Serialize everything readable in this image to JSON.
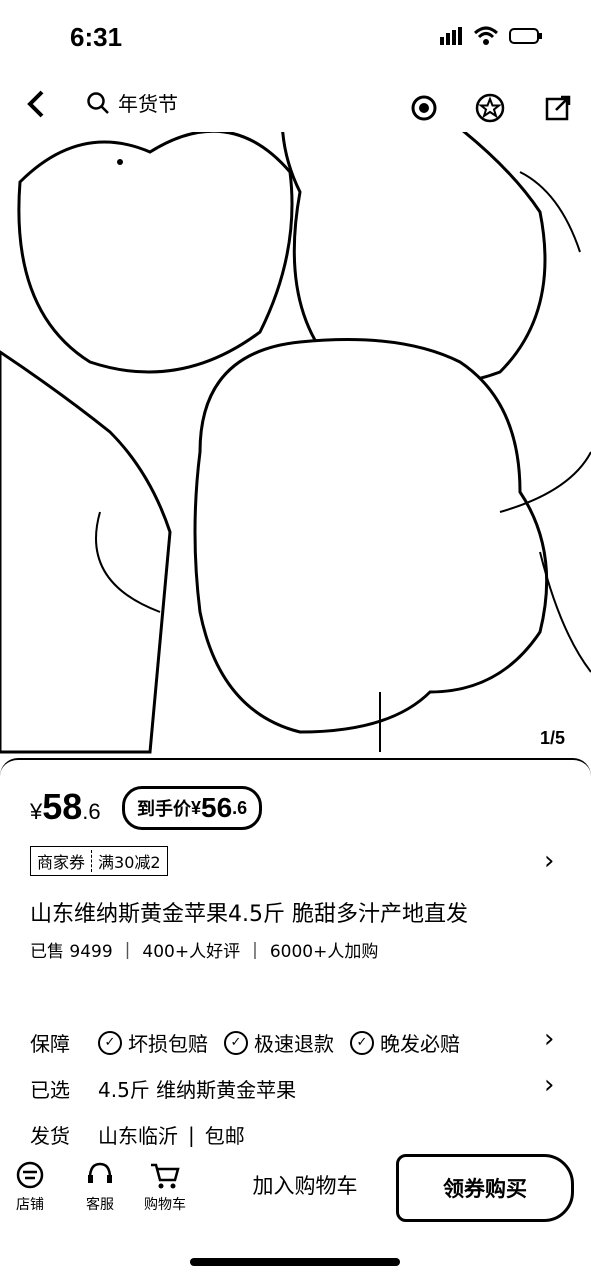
{
  "status_bar": {
    "time": "6:31"
  },
  "topbar": {
    "search_text": "年货节"
  },
  "gallery": {
    "counter": "1/5"
  },
  "price": {
    "currency": "¥",
    "integer": "58",
    "decimal": ".6"
  },
  "final_price": {
    "label": "到手价",
    "currency": "¥",
    "integer": "56",
    "decimal": ".6"
  },
  "coupon": {
    "type": "商家券",
    "rule": "满30减2"
  },
  "product": {
    "title": "山东维纳斯黄金苹果4.5斤 脆甜多汁产地直发"
  },
  "stats": {
    "sold": "已售 9499",
    "reviews": "400+人好评",
    "carted": "6000+人加购"
  },
  "guarantee": {
    "label": "保障",
    "items": [
      "坏损包赔",
      "极速退款",
      "晚发必赔"
    ]
  },
  "selected": {
    "label": "已选",
    "value": "4.5斤 维纳斯黄金苹果"
  },
  "shipping": {
    "label": "发货",
    "origin": "山东临沂",
    "fee": "包邮"
  },
  "bottom_bar": {
    "shop": "店铺",
    "service": "客服",
    "cart": "购物车",
    "add_to_cart": "加入购物车",
    "buy": "领券购买"
  }
}
